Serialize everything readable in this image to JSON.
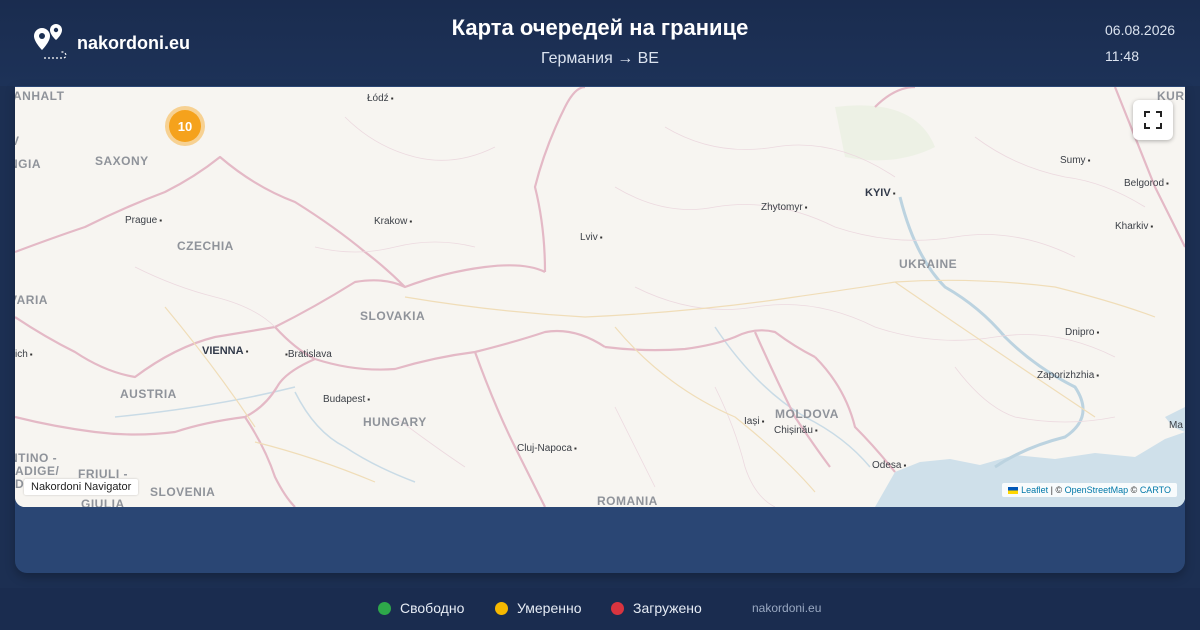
{
  "header": {
    "site_name": "nakordoni.eu",
    "title": "Карта очередей на границе",
    "subtitle": "Германия → BE",
    "date": "06.08.2026",
    "time": "11:48"
  },
  "map": {
    "cluster_count": "10",
    "badge": "Nakordoni Navigator",
    "attribution": {
      "leaflet": "Leaflet",
      "sep1": " | © ",
      "osm": "OpenStreetMap",
      "sep2": " © ",
      "carto": "CARTO"
    },
    "countries": [
      "ANHALT",
      "SAXONY",
      "NGIA",
      "CZECHIA",
      "VARIA",
      "SLOVAKIA",
      "AUSTRIA",
      "HUNGARY",
      "UKRAINE",
      "MOLDOVA",
      "ROMANIA",
      "SLOVENIA",
      "KURSK",
      "NTINO -",
      "ADIGE/",
      "DT",
      "FRIULI -",
      "GIULIA"
    ],
    "cities": [
      "Łódź",
      "Prague",
      "Krakow",
      "Lviv",
      "Zhytomyr",
      "Sumy",
      "Belgorod",
      "Kharkiv",
      "Bratislava",
      "Budapest",
      "Dnipro",
      "Zaporizhzhia",
      "Iași",
      "Chișinău",
      "Cluj-Napoca",
      "Odesa",
      "ich",
      "Ma",
      "V"
    ],
    "capitals": [
      "KYIV",
      "VIENNA"
    ],
    "icons": [
      "map-pin-icon",
      "fullscreen-icon"
    ],
    "colors": {
      "land": "#f7f5f1",
      "water": "#cfe0ea",
      "cluster": "#f5a21c"
    }
  },
  "legend": [
    {
      "label": "Свободно",
      "color": "#2ea84a"
    },
    {
      "label": "Умеренно",
      "color": "#f5b800"
    },
    {
      "label": "Загружено",
      "color": "#d9343f"
    }
  ],
  "footer": {
    "site": "nakordoni.eu"
  }
}
